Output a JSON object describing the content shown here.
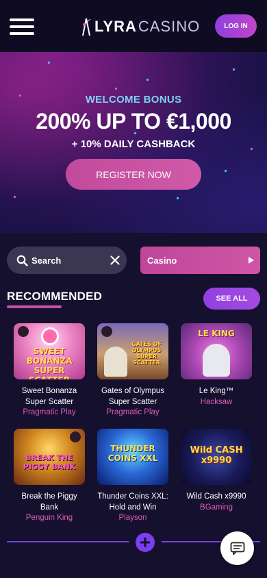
{
  "header": {
    "logo_primary": "LYRA",
    "logo_secondary": "CASINO",
    "login_label": "LOG IN"
  },
  "hero": {
    "eyebrow": "WELCOME BONUS",
    "headline": "200% UP TO €1,000",
    "subline": "+ 10% DAILY CASHBACK",
    "cta_label": "REGISTER NOW"
  },
  "search": {
    "value": "Search"
  },
  "category_select": {
    "selected": "Casino"
  },
  "recommended": {
    "title": "RECOMMENDED",
    "see_all_label": "SEE ALL",
    "games": [
      {
        "name": "Sweet Bonanza Super Scatter",
        "provider": "Pragmatic Play",
        "art_text": "SWEET BONANZA SUPER SCATTER"
      },
      {
        "name": "Gates of Olympus Super Scatter",
        "provider": "Pragmatic Play",
        "art_text": "GATES OF OLYMPUS SUPER SCATTER"
      },
      {
        "name": "Le King™",
        "provider": "Hacksaw",
        "art_text": "LE KING"
      },
      {
        "name": "Break the Piggy Bank",
        "provider": "Penguin King",
        "art_text": "BREAK THE PIGGY BANK"
      },
      {
        "name": "Thunder Coins XXL: Hold and Win",
        "provider": "Playson",
        "art_text": "THUNDER COINS XXL"
      },
      {
        "name": "Wild Cash x9990",
        "provider": "BGaming",
        "art_text": "Wild CASH x9990"
      }
    ]
  },
  "colors": {
    "background": "#15102e",
    "accent_pink": "#c64fa8",
    "accent_purple": "#7b3ff0",
    "provider_text": "#e35cb8",
    "welcome_text": "#7fd0f0"
  },
  "icons": [
    "menu-icon",
    "lyra-logo-icon",
    "search-icon",
    "close-icon",
    "caret-right-icon",
    "plus-icon",
    "chat-icon"
  ]
}
